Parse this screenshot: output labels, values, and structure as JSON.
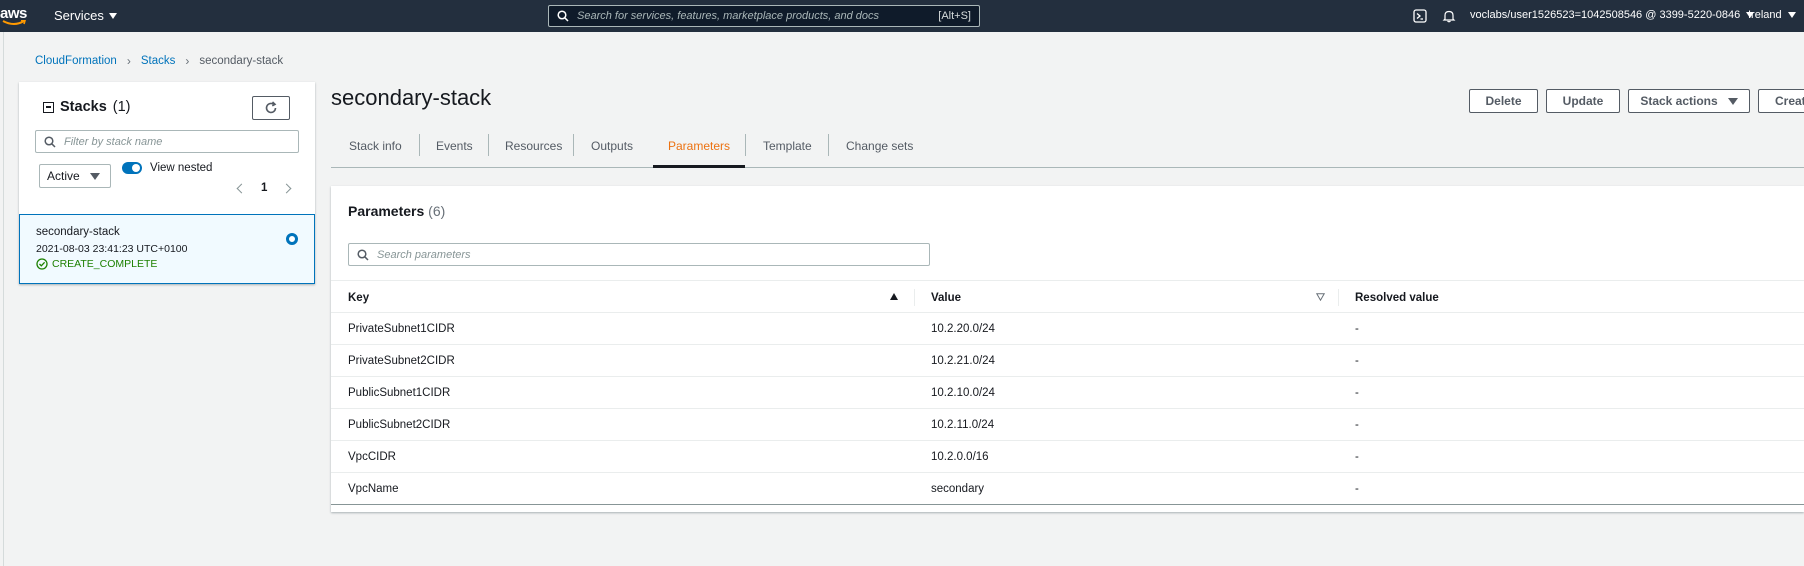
{
  "nav": {
    "logo": "aws",
    "services_label": "Services",
    "search_placeholder": "Search for services, features, marketplace products, and docs",
    "search_shortcut": "[Alt+S]",
    "account": "voclabs/user1526523=1042508546 @ 3399-5220-0846",
    "region": "Ireland"
  },
  "breadcrumb": {
    "items": [
      "CloudFormation",
      "Stacks",
      "secondary-stack"
    ]
  },
  "stacks_panel": {
    "title": "Stacks",
    "count": "(1)",
    "filter_placeholder": "Filter by stack name",
    "status_filter": "Active",
    "toggle_label": "View nested",
    "toggle_on": true,
    "page": "1",
    "stack": {
      "name": "secondary-stack",
      "date": "2021-08-03 23:41:23 UTC+0100",
      "status": "CREATE_COMPLETE",
      "status_color": "#1d8102"
    }
  },
  "main": {
    "title": "secondary-stack",
    "buttons": {
      "delete": "Delete",
      "update": "Update",
      "stack_actions": "Stack actions",
      "create": "Creat"
    },
    "tabs": [
      "Stack info",
      "Events",
      "Resources",
      "Outputs",
      "Parameters",
      "Template",
      "Change sets"
    ],
    "active_tab": "Parameters",
    "accent_color": "#ec7211"
  },
  "parameters": {
    "title": "Parameters",
    "count": "(6)",
    "search_placeholder": "Search parameters",
    "columns": [
      "Key",
      "Value",
      "Resolved value"
    ],
    "rows": [
      {
        "key": "PrivateSubnet1CIDR",
        "value": "10.2.20.0/24",
        "resolved": "-"
      },
      {
        "key": "PrivateSubnet2CIDR",
        "value": "10.2.21.0/24",
        "resolved": "-"
      },
      {
        "key": "PublicSubnet1CIDR",
        "value": "10.2.10.0/24",
        "resolved": "-"
      },
      {
        "key": "PublicSubnet2CIDR",
        "value": "10.2.11.0/24",
        "resolved": "-"
      },
      {
        "key": "VpcCIDR",
        "value": "10.2.0.0/16",
        "resolved": "-"
      },
      {
        "key": "VpcName",
        "value": "secondary",
        "resolved": "-"
      }
    ]
  }
}
